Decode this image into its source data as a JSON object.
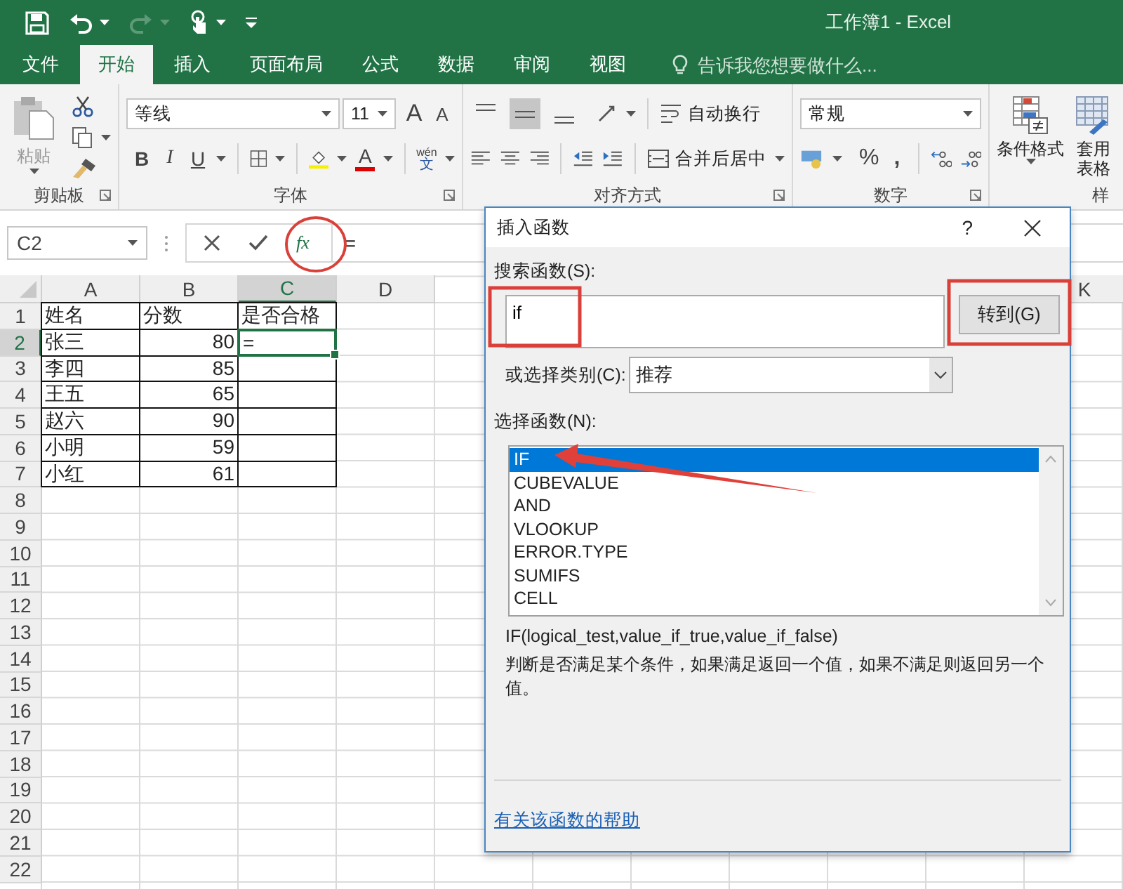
{
  "window": {
    "title": "工作簿1 - Excel"
  },
  "quick_access": {
    "redo_disabled": true
  },
  "tabs": [
    {
      "label": "文件",
      "selected": false
    },
    {
      "label": "开始",
      "selected": true
    },
    {
      "label": "插入",
      "selected": false
    },
    {
      "label": "页面布局",
      "selected": false
    },
    {
      "label": "公式",
      "selected": false
    },
    {
      "label": "数据",
      "selected": false
    },
    {
      "label": "审阅",
      "selected": false
    },
    {
      "label": "视图",
      "selected": false
    }
  ],
  "tell_me": {
    "placeholder": "告诉我您想要做什么..."
  },
  "ribbon": {
    "clipboard": {
      "label": "剪贴板",
      "paste": "粘贴"
    },
    "font": {
      "label": "字体",
      "font_name": "等线",
      "font_size": "11",
      "grow": "A",
      "shrink": "A",
      "styles": [
        "B",
        "I",
        "U"
      ],
      "font_color": "A",
      "phonetic": [
        "wén",
        "文"
      ]
    },
    "alignment": {
      "label": "对齐方式",
      "vertical_align": [
        {
          "selected": false
        },
        {
          "selected": true
        },
        {
          "selected": false
        }
      ],
      "wrap_text": "自动换行",
      "merge": "合并后居中"
    },
    "number": {
      "label": "数字",
      "format": "常规",
      "percent": "%",
      "comma": ","
    },
    "styles": {
      "label": "样",
      "conditional_format": "条件格式",
      "table_format": [
        "套用",
        "表格"
      ]
    }
  },
  "formula_bar": {
    "name_box": "C2",
    "function_button": "fx",
    "formula": "="
  },
  "sheet": {
    "columns": [
      {
        "label": "A",
        "selected": false
      },
      {
        "label": "B",
        "selected": false
      },
      {
        "label": "C",
        "selected": true
      },
      {
        "label": "D",
        "selected": false
      },
      {
        "label": "K",
        "selected": false
      }
    ],
    "rows": [
      {
        "header": "1",
        "selected": false,
        "cells": [
          {
            "kind": "text",
            "text": "姓名",
            "active": false
          },
          {
            "kind": "text",
            "text": "分数",
            "active": false
          },
          {
            "kind": "text",
            "text": "是否合格",
            "active": false
          }
        ]
      },
      {
        "header": "2",
        "selected": true,
        "cells": [
          {
            "kind": "text",
            "text": "张三",
            "active": false
          },
          {
            "kind": "number",
            "text": "80",
            "active": false
          },
          {
            "kind": "text",
            "text": "=",
            "active": true
          }
        ]
      },
      {
        "header": "3",
        "selected": false,
        "cells": [
          {
            "kind": "text",
            "text": "李四",
            "active": false
          },
          {
            "kind": "number",
            "text": "85",
            "active": false
          },
          {
            "kind": "text",
            "active": false
          }
        ]
      },
      {
        "header": "4",
        "selected": false,
        "cells": [
          {
            "kind": "text",
            "text": "王五",
            "active": false
          },
          {
            "kind": "number",
            "text": "65",
            "active": false
          },
          {
            "kind": "text",
            "active": false
          }
        ]
      },
      {
        "header": "5",
        "selected": false,
        "cells": [
          {
            "kind": "text",
            "text": "赵六",
            "active": false
          },
          {
            "kind": "number",
            "text": "90",
            "active": false
          },
          {
            "kind": "text",
            "active": false
          }
        ]
      },
      {
        "header": "6",
        "selected": false,
        "cells": [
          {
            "kind": "text",
            "text": "小明",
            "active": false
          },
          {
            "kind": "number",
            "text": "59",
            "active": false
          },
          {
            "kind": "text",
            "active": false
          }
        ]
      },
      {
        "header": "7",
        "selected": false,
        "cells": [
          {
            "kind": "text",
            "text": "小红",
            "active": false
          },
          {
            "kind": "number",
            "text": "61",
            "active": false
          },
          {
            "kind": "text",
            "active": false
          }
        ]
      },
      {
        "header": "8",
        "selected": false
      },
      {
        "header": "9",
        "selected": false
      },
      {
        "header": "10",
        "selected": false
      },
      {
        "header": "11",
        "selected": false
      },
      {
        "header": "12",
        "selected": false
      },
      {
        "header": "13",
        "selected": false
      },
      {
        "header": "14",
        "selected": false
      },
      {
        "header": "15",
        "selected": false
      },
      {
        "header": "16",
        "selected": false
      },
      {
        "header": "17",
        "selected": false
      },
      {
        "header": "18",
        "selected": false
      },
      {
        "header": "19",
        "selected": false
      },
      {
        "header": "20",
        "selected": false
      },
      {
        "header": "21",
        "selected": false
      },
      {
        "header": "22",
        "selected": false
      }
    ]
  },
  "dialog": {
    "title": "插入函数",
    "help": "?",
    "search_label": "搜索函数(S):",
    "search_value": "if",
    "go_button": "转到(G)",
    "category_label": "或选择类别(C):",
    "category_value": "推荐",
    "list_label": "选择函数(N):",
    "functions": [
      {
        "label": "IF",
        "selected": true
      },
      {
        "label": "CUBEVALUE",
        "selected": false
      },
      {
        "label": "AND",
        "selected": false
      },
      {
        "label": "VLOOKUP",
        "selected": false
      },
      {
        "label": "ERROR.TYPE",
        "selected": false
      },
      {
        "label": "SUMIFS",
        "selected": false
      },
      {
        "label": "CELL",
        "selected": false
      }
    ],
    "signature": "IF(logical_test,value_if_true,value_if_false)",
    "description": "判断是否满足某个条件，如果满足返回一个值，如果不满足则返回另一个值。",
    "help_link": "有关该函数的帮助"
  }
}
